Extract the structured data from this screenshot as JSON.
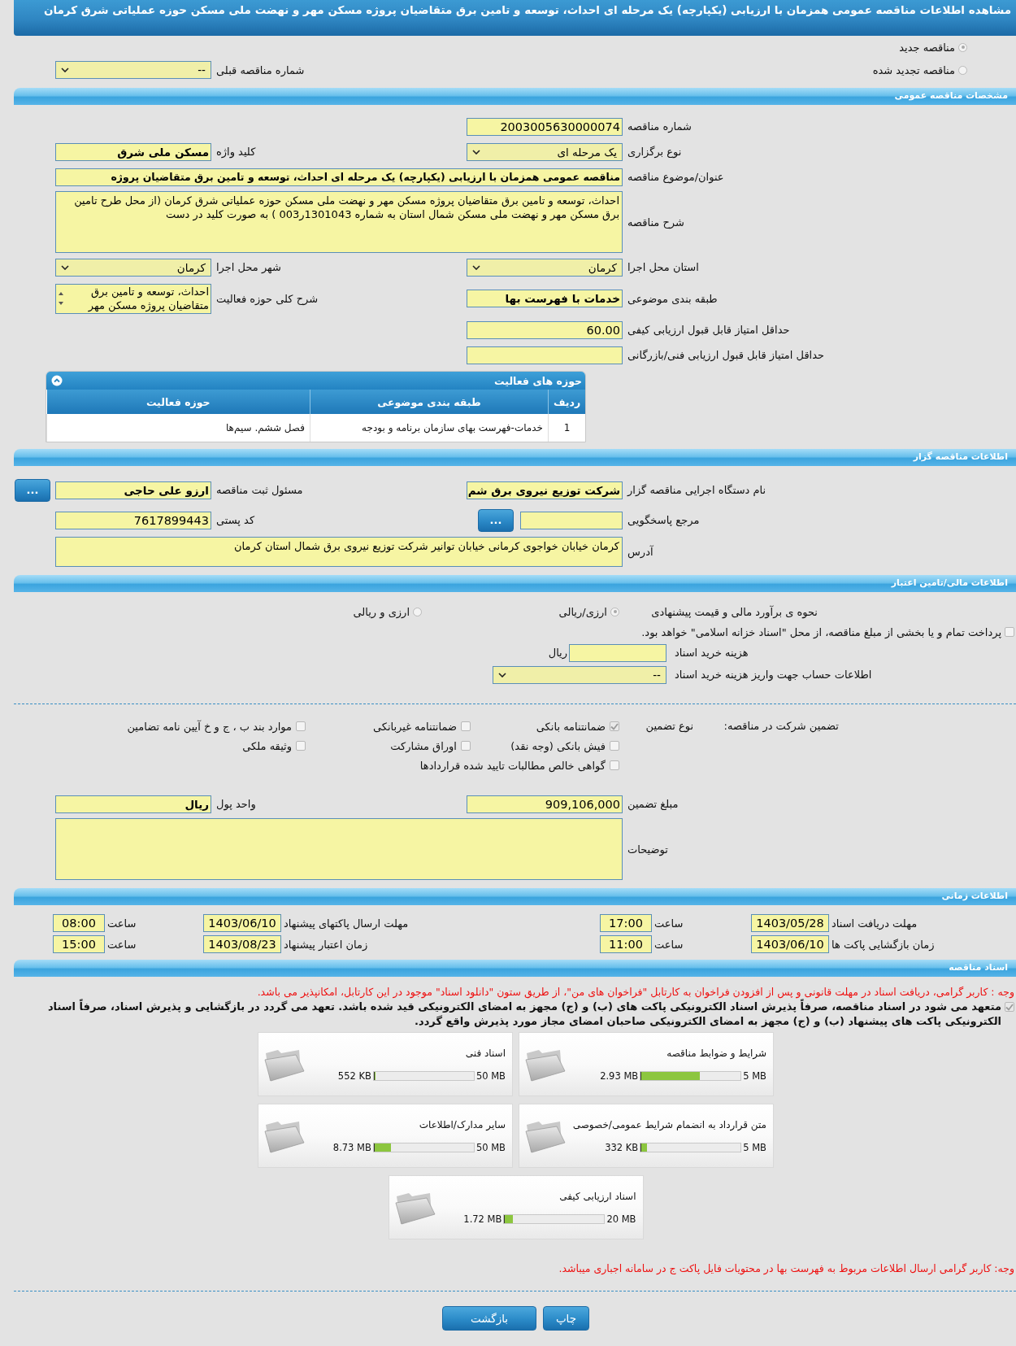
{
  "title": "مشاهده اطلاعات مناقصه عمومی همزمان با ارزیابی (یکپارچه) یک مرحله ای احداث، توسعه و تامین برق متقاضیان پروژه مسکن مهر و نهضت ملی مسکن حوزه عملیاتی شرق کرمان",
  "tender_status": {
    "options": [
      {
        "label": "مناقصه جدید",
        "selected": true
      },
      {
        "label": "مناقصه تجدید شده",
        "selected": false
      }
    ],
    "previous": {
      "label": "شماره مناقصه قبلی",
      "kind": "select",
      "value": "--"
    }
  },
  "general": {
    "heading": "مشخصات مناقصه عمومی",
    "rows": [
      {
        "right": {
          "label": "شماره مناقصه",
          "kind": "input",
          "value": "2003005630000074"
        }
      },
      {
        "right": {
          "label": "نوع برگزاری",
          "kind": "select",
          "value": "یک مرحله ای"
        },
        "left": {
          "label": "کلید واژه",
          "kind": "input",
          "value": "مسکن ملی شرق",
          "bold": true
        }
      },
      {
        "wide": {
          "label": "عنوان/موضوع مناقصه",
          "kind": "input",
          "value": "مناقصه عمومی همزمان با ارزیابی (یکپارچه) یک مرحله ای احداث، توسعه و تامین برق متقاضیان پروژه",
          "bold": true
        }
      },
      {
        "wide": {
          "label": "شرح مناقصه",
          "kind": "textarea",
          "value": "احداث، توسعه و تامین برق متقاضیان پروژه مسکن مهر و نهضت ملی مسکن حوزه عملیاتی شرق کرمان (از محل طرح تامین برق مسکن مهر و نهضت ملی مسکن شمال استان به شماره 1301043ر003 ) به صورت کلید در دست"
        }
      },
      {
        "right": {
          "label": "استان محل اجرا",
          "kind": "select",
          "value": "کرمان"
        },
        "left": {
          "label": "شهر محل اجرا",
          "kind": "select",
          "value": "کرمان"
        }
      },
      {
        "right": {
          "label": "طبقه بندی موضوعی",
          "kind": "input",
          "value": "خدمات با فهرست بها",
          "bold": true
        },
        "left": {
          "label": "شرح کلی حوزه فعالیت",
          "kind": "listbox",
          "value": "احداث، توسعه و تامین برق متقاضیان پروژه مسکن مهر"
        }
      },
      {
        "right": {
          "label": "حداقل امتیاز قابل قبول ارزیابی کیفی",
          "kind": "input",
          "value": "60.00"
        }
      },
      {
        "right": {
          "label": "حداقل امتیاز قابل قبول ارزیابی فنی/بازرگانی",
          "kind": "input"
        }
      }
    ],
    "activities": {
      "title": "حوزه های فعالیت",
      "columns": [
        "ردیف",
        "طبقه بندی موضوعی",
        "حوزه فعالیت"
      ],
      "rows": [
        [
          "1",
          "خدمات-فهرست بهای سازمان برنامه و بودجه",
          "فصل ششم. سیم‌ها"
        ]
      ]
    }
  },
  "organizer": {
    "heading": "اطلاعات مناقصه گزار",
    "rows": [
      {
        "right": {
          "label": "نام دستگاه اجرایی مناقصه گزار",
          "kind": "input",
          "value": "شرکت توزیع نیروی برق شم",
          "bold": true
        },
        "left": {
          "label": "مسئول ثبت مناقصه",
          "kind": "input",
          "value": "ارزو علی حاجی",
          "bold": true,
          "button": "..."
        }
      },
      {
        "right": {
          "label": "مرجع پاسخگویی",
          "kind": "input",
          "button": "..."
        },
        "left": {
          "label": "کد پستی",
          "kind": "input",
          "value": "7617899443"
        }
      },
      {
        "wide": {
          "label": "آدرس",
          "kind": "short-textarea",
          "value": "کرمان خیابان خواجوی کرمانی خیابان توانیر شرکت توزیع نیروی برق شمال استان کرمان"
        }
      }
    ]
  },
  "finance": {
    "heading": "اطلاعات مالی/تامین اعتبار",
    "estimate": {
      "label": "نحوه ی برآورد مالی و قیمت پیشنهادی",
      "options": [
        {
          "label": "ارزی/ریالی",
          "selected": true
        },
        {
          "label": "ارزی و ریالی",
          "selected": false
        }
      ]
    },
    "treasury": {
      "label": "پرداخت تمام و یا بخشی از مبلغ مناقصه، از محل \"اسناد خزانه اسلامی\" خواهد بود.",
      "checked": false
    },
    "rows": [
      {
        "label": "هزینه خرید اسناد",
        "kind": "input",
        "suffix": "ریال"
      },
      {
        "label": "اطلاعات حساب جهت واریز هزینه خرید اسناد",
        "kind": "select",
        "value": "--"
      }
    ]
  },
  "guarantee": {
    "label": "تضمین شرکت در مناقصه:",
    "type_label": "نوع تضمین",
    "options": [
      {
        "label": "ضمانتنامه بانکی",
        "checked": true
      },
      {
        "label": "ضمانتنامه غیربانکی",
        "checked": false
      },
      {
        "label": "موارد بند ب ، ج و خ آیین نامه تضامین",
        "checked": false
      },
      {
        "label": "فیش بانکی (وجه نقد)",
        "checked": false
      },
      {
        "label": "اوراق مشارکت",
        "checked": false
      },
      {
        "label": "وثیقه ملکی",
        "checked": false
      },
      {
        "label": "گواهی خالص مطالبات تایید شده قراردادها",
        "checked": false
      }
    ],
    "rows": [
      {
        "right": {
          "label": "مبلغ تضمین",
          "kind": "input",
          "value": "909,106,000"
        },
        "left": {
          "label": "واحد پول",
          "kind": "input",
          "value": "ریال",
          "bold": true
        }
      },
      {
        "wide": {
          "label": "توضیحات",
          "kind": "textarea"
        }
      }
    ]
  },
  "schedule": {
    "heading": "اطلاعات زمانی",
    "items": [
      {
        "label": "مهلت دریافت اسناد",
        "date": "1403/05/28",
        "time_label": "ساعت",
        "time": "17:00"
      },
      {
        "label": "مهلت ارسال پاکتهای پیشنهاد",
        "date": "1403/06/10",
        "time_label": "ساعت",
        "time": "08:00"
      },
      {
        "label": "زمان بازگشایی پاکت ها",
        "date": "1403/06/10",
        "time_label": "ساعت",
        "time": "11:00"
      },
      {
        "label": "زمان اعتبار پیشنهاد",
        "date": "1403/08/23",
        "time_label": "ساعت",
        "time": "15:00"
      }
    ]
  },
  "documents": {
    "heading": "اسناد مناقصه",
    "notice": "وجه : کاربر گرامی، دریافت اسناد در مهلت قانونی و پس از افزودن فراخوان به کارتابل \"فراخوان های من\"، از طریق ستون \"دانلود اسناد\" موجود در این کارتابل، امکانپذیر می باشد.",
    "pledge": {
      "text": "متعهد می شود در اسناد مناقصه، صرفاً پذیرش اسناد الکترونیکی پاکت های (ب) و (ج) مجهز به امضای الکترونیکی قید شده باشد. تعهد می گردد در بازگشایی و پذیرش اسناد، صرفاً اسناد الکترونیکی پاکت های پیشنهاد (ب) و (ج) مجهز به امضای الکترونیکی صاحبان امضای مجاز مورد پذیرش واقع گردد.",
      "checked": true
    },
    "files": [
      {
        "title": "شرایط و ضوابط مناقصه",
        "max": "5 MB",
        "used": "2.93 MB",
        "level": 0.59
      },
      {
        "title": "اسناد فنی",
        "max": "50 MB",
        "used": "552 KB",
        "level": 0.011
      },
      {
        "title": "متن قرارداد به انضمام شرایط عمومی/خصوصی",
        "max": "5 MB",
        "used": "332 KB",
        "level": 0.065
      },
      {
        "title": "سایر مدارک/اطلاعات",
        "max": "50 MB",
        "used": "8.73 MB",
        "level": 0.17
      },
      {
        "title": "اسناد ارزیابی کیفی",
        "max": "20 MB",
        "used": "1.72 MB",
        "level": 0.086
      }
    ],
    "footer_note": "وجه: کاربر گرامی ارسال اطلاعات مربوط به فهرست بها در محتویات فایل پاکت ج در سامانه اجباری میباشد."
  },
  "buttons": [
    {
      "label": "چاپ"
    },
    {
      "label": "بازگشت"
    }
  ]
}
